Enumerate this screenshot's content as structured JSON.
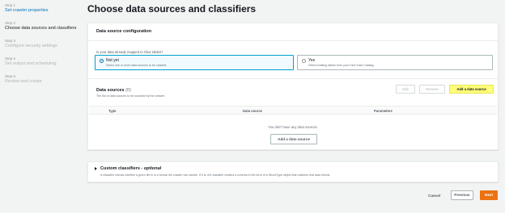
{
  "steps": [
    {
      "num": "Step 1",
      "title": "Set crawler properties",
      "state": "done"
    },
    {
      "num": "Step 2",
      "title": "Choose data sources and classifiers",
      "state": "active"
    },
    {
      "num": "Step 3",
      "title": "Configure security settings",
      "state": "pending"
    },
    {
      "num": "Step 4",
      "title": "Set output and scheduling",
      "state": "pending"
    },
    {
      "num": "Step 5",
      "title": "Review and create",
      "state": "pending"
    }
  ],
  "page_title": "Choose data sources and classifiers",
  "ds_config": {
    "title": "Data source configuration",
    "question": "Is your data already mapped to Glue tables?",
    "options": [
      {
        "label": "Not yet",
        "desc": "Select one or more data sources to be crawled.",
        "selected": true
      },
      {
        "label": "Yes",
        "desc": "Select existing tables from your Glue Data Catalog.",
        "selected": false
      }
    ]
  },
  "data_sources": {
    "title": "Data sources",
    "count": "(0)",
    "subtitle": "The list of data sources to be scanned by the crawler.",
    "edit_label": "Edit",
    "remove_label": "Remove",
    "add_label": "Add a data source",
    "columns": [
      "Type",
      "Data source",
      "Parameters"
    ],
    "empty_message": "You don't have any data sources.",
    "empty_add_label": "Add a data source"
  },
  "custom_classifiers": {
    "title": "Custom classifiers - ",
    "title_optional": "optional",
    "desc": "A classifier checks whether a given file is in a format the crawler can handle. If it is, the classifier creates a schema in the form of a StructType object that matches that data format."
  },
  "footer": {
    "cancel_label": "Cancel",
    "previous_label": "Previous",
    "next_label": "Next"
  },
  "colors": {
    "link": "#0073bb",
    "primary_button": "#ec7211",
    "highlight": "#ffff7a"
  }
}
